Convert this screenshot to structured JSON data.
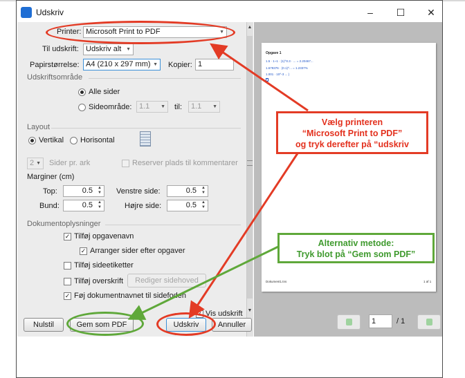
{
  "window": {
    "title": "Udskriv",
    "controls": {
      "minimize": "–",
      "maximize": "☐",
      "close": "✕"
    }
  },
  "printer": {
    "label": "Printer:",
    "value": "Microsoft Print to PDF"
  },
  "til_udskrift": {
    "label": "Til udskrift:",
    "value": "Udskriv alt"
  },
  "papir": {
    "label": "Papirstørrelse:",
    "value": "A4 (210 x 297 mm)"
  },
  "kopier": {
    "label": "Kopier:",
    "value": "1"
  },
  "udskriftsomraade": {
    "section": "Udskriftsområde",
    "alle": "Alle sider",
    "sideomraade": "Sideområde:",
    "from": "1.1",
    "til_label": "til:",
    "to": "1.1"
  },
  "layout": {
    "section": "Layout",
    "vertikal": "Vertikal",
    "horisontal": "Horisontal",
    "sider_value": "2",
    "sider_label": "Sider pr. ark",
    "reserver": "Reserver plads til kommentarer"
  },
  "margins": {
    "section": "Marginer (cm)",
    "top_label": "Top:",
    "top_value": "0.5",
    "bund_label": "Bund:",
    "bund_value": "0.5",
    "venstre_label": "Venstre side:",
    "venstre_value": "0.5",
    "hoejre_label": "Højre side:",
    "hoejre_value": "0.5"
  },
  "doc": {
    "section": "Dokumentoplysninger",
    "opgavenavn": "Tilføj opgavenavn",
    "arranger": "Arranger sider efter opgaver",
    "sideetiketter": "Tilføj sideetiketter",
    "overskrift": "Tilføj overskrift",
    "rediger": "Rediger sidehoved",
    "foej": "Føj dokumentnavnet til sidefoden"
  },
  "buttons": {
    "vis": "Vis udskrift",
    "nulstil": "Nulstil",
    "gem": "Gem som PDF",
    "udskriv": "Udskriv",
    "annuller": "Annuller"
  },
  "pager": {
    "current": "1",
    "total": "/ 1"
  },
  "preview": {
    "title": "Opgave 1",
    "line1": "1.5 · 1~1 · (1)^0.3 · ... = 2.20467... ",
    "line2": "1.679376 · (0.1)^... = 1.2337%",
    "line3": "1.001 · 10^-3 ... ) ",
    "footer_left": "Dokument1.tns",
    "footer_right": "1 af 1"
  },
  "annotations": {
    "red_line1": "Vælg printeren",
    "red_line2": "“Microsoft Print to PDF”",
    "red_line3": "og tryk derefter på “udskriv",
    "green_line1": "Alternativ metode:",
    "green_line2": "Tryk blot på “Gem som PDF”"
  },
  "colors": {
    "red": "#e33b25",
    "green": "#5fa83a",
    "accent": "#1f6ed4"
  }
}
